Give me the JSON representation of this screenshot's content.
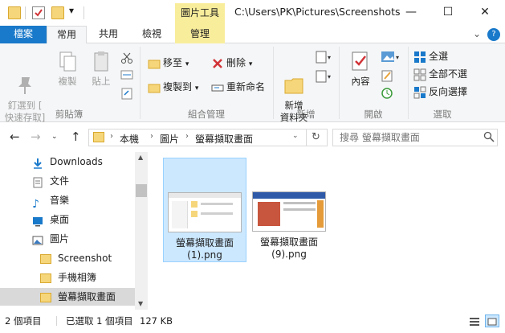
{
  "titlebar": {
    "context_tab": "圖片工具",
    "path_title": "C:\\Users\\PK\\Pictures\\Screenshots",
    "qat_dropdown": "▾",
    "min": "—",
    "max": "☐",
    "close": "✕"
  },
  "tabs": {
    "file": "檔案",
    "home": "常用",
    "share": "共用",
    "view": "檢視",
    "manage": "管理",
    "chevron": "⌄",
    "help": "?"
  },
  "ribbon": {
    "pin_label": "釘選到 [\n快速存取]",
    "copy_label": "複製",
    "paste_label": "貼上",
    "group_clipboard": "剪貼簿",
    "move_to": "移至",
    "copy_to": "複製到",
    "delete": "刪除",
    "rename": "重新命名",
    "group_organize": "組合管理",
    "new_folder": "新增\n資料夾",
    "group_new": "新增",
    "properties": "內容",
    "group_open": "開啟",
    "select_all": "全選",
    "select_none": "全部不選",
    "invert_selection": "反向選擇",
    "group_select": "選取"
  },
  "address": {
    "crumbs": [
      "本機",
      "圖片",
      "螢幕擷取畫面"
    ],
    "search_placeholder": "搜尋 螢幕擷取畫面"
  },
  "nav": {
    "items": [
      "Downloads",
      "文件",
      "音樂",
      "桌面",
      "圖片",
      "Screenshot",
      "手機相簿",
      "螢幕擷取畫面"
    ]
  },
  "files": [
    {
      "name": "螢幕擷取畫面\n(1).png",
      "selected": true
    },
    {
      "name": "螢幕擷取畫面\n(9).png",
      "selected": false
    }
  ],
  "status": {
    "count": "2 個項目",
    "selected": "已選取 1 個項目",
    "size": "127 KB"
  },
  "colors": {
    "accent": "#1979ca",
    "selection": "#cce8ff",
    "context_tab": "#f8ed9b"
  }
}
